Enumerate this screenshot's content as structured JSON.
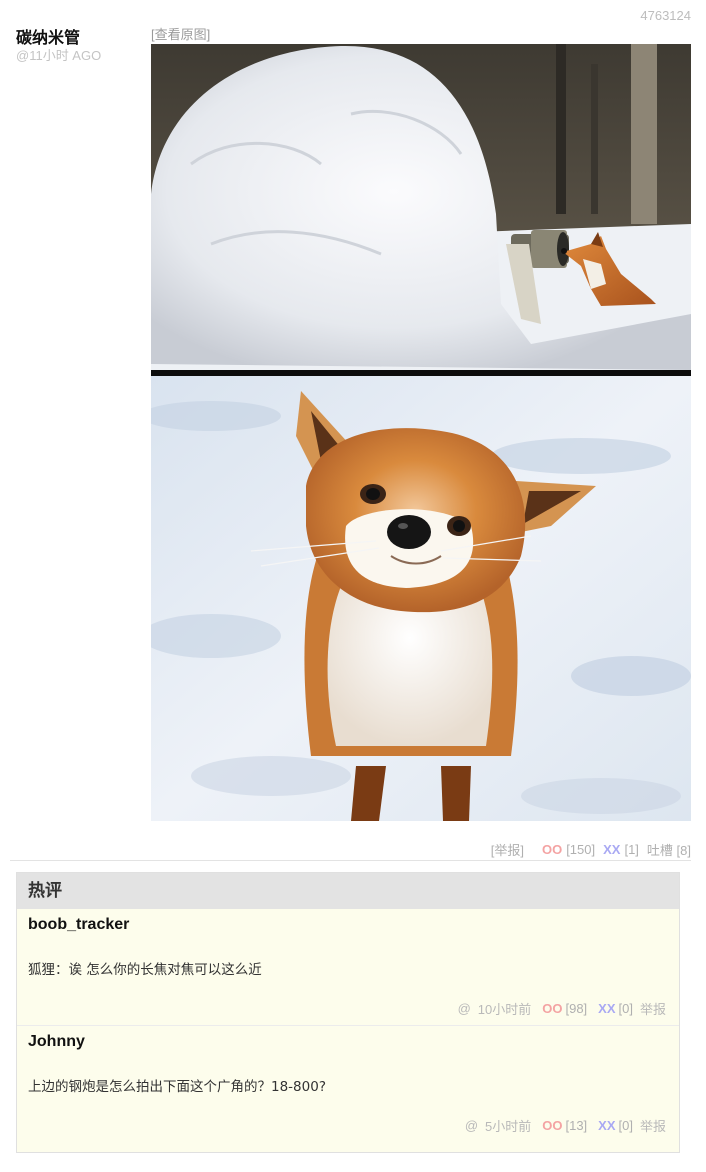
{
  "post": {
    "id": "4763124",
    "author": "碳纳米管",
    "time": "@11小时 AGO",
    "view_original": "[查看原图]",
    "report": "[举报]",
    "oo_label": "OO",
    "oo_count": "[150]",
    "xx_label": "XX",
    "xx_count": "[1]",
    "tucao": "吐槽 [8]"
  },
  "hot_comments": {
    "title": "热评",
    "items": [
      {
        "author": "boob_tracker",
        "text": "狐狸：诶 怎么你的长焦对焦可以这么近",
        "at": "@",
        "time": "10小时前",
        "oo_label": "OO",
        "oo_count": "[98]",
        "xx_label": "XX",
        "xx_count": "[0]",
        "report": "举报"
      },
      {
        "author": "Johnny",
        "text": "上边的钢炮是怎么拍出下面这个广角的？18-800?",
        "at": "@",
        "time": "5小时前",
        "oo_label": "OO",
        "oo_count": "[13]",
        "xx_label": "XX",
        "xx_count": "[0]",
        "report": "举报"
      }
    ]
  }
}
